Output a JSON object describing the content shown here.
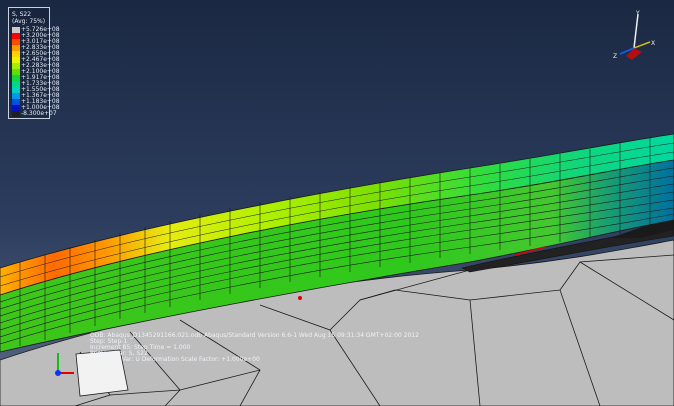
{
  "legend": {
    "title": "S, S22",
    "subtitle": "(Avg: 75%)",
    "entries": [
      {
        "label": "+5.726e+08",
        "color": "#c9c9c9"
      },
      {
        "label": "+3.200e+08",
        "color": "#ff0000"
      },
      {
        "label": "+3.017e+08",
        "color": "#ff4d00"
      },
      {
        "label": "+2.833e+08",
        "color": "#ff9900"
      },
      {
        "label": "+2.650e+08",
        "color": "#ffd500"
      },
      {
        "label": "+2.467e+08",
        "color": "#e6f500"
      },
      {
        "label": "+2.283e+08",
        "color": "#a8ec00"
      },
      {
        "label": "+2.100e+08",
        "color": "#5fe000"
      },
      {
        "label": "+1.917e+08",
        "color": "#10d640"
      },
      {
        "label": "+1.733e+08",
        "color": "#00d68c"
      },
      {
        "label": "+1.550e+08",
        "color": "#00cfc8"
      },
      {
        "label": "+1.367e+08",
        "color": "#0098e6"
      },
      {
        "label": "+1.183e+08",
        "color": "#0050e0"
      },
      {
        "label": "+1.000e+08",
        "color": "#0010c8"
      },
      {
        "label": "-8.300e+07",
        "color": "#202020"
      }
    ]
  },
  "info": {
    "line1": "ODB: Abaqus_D1345291166.021.odb    Abaqus/Standard Version 6.6-1    Wed Aug 15 09:31:34 GMT+02:00 2012",
    "line2": "Step: Step-1",
    "line3": "Increment    85: Step Time =    1.000",
    "line4": "Primary Var: S, S22",
    "line5": "Deformed Var: U   Deformation Scale Factor: +1.000e+00"
  },
  "triad": {
    "x": "X",
    "y": "Y",
    "z": "Z"
  },
  "colors": {
    "background_top": "#1b2a44",
    "background_bottom": "#5a6a85",
    "substrate": "#b9b9b9",
    "mesh_line": "#1a1a1a",
    "band_green": "#2fd21a"
  }
}
